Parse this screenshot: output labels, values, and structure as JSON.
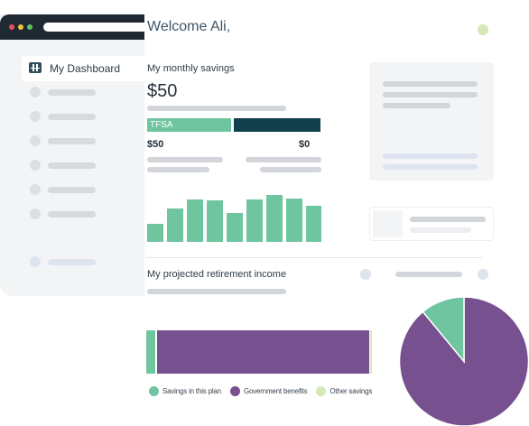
{
  "colors": {
    "green": "#6fc59f",
    "teal_dark": "#123f4c",
    "purple": "#76508f",
    "light_green": "#d4e8b8",
    "dot_red": "#e8505b",
    "dot_yellow": "#f4c542",
    "dot_green": "#5cc46b"
  },
  "sidebar": {
    "active_item": {
      "label": "My Dashboard",
      "icon": "grid-icon"
    }
  },
  "header": {
    "welcome": "Welcome Ali,"
  },
  "savings": {
    "title": "My monthly savings",
    "amount": "$50",
    "split_label": "TFSA",
    "left_value": "$50",
    "right_value": "$0",
    "split_fraction": 0.49
  },
  "mini_bars": [
    0.38,
    0.72,
    0.9,
    0.88,
    0.62,
    0.9,
    1.0,
    0.92,
    0.76,
    0.9
  ],
  "retirement": {
    "title": "My projected retirement income",
    "legend": [
      "Savings in this plan",
      "Government benefits",
      "Other savings"
    ]
  },
  "chart_data": {
    "type": "pie",
    "labels": [
      "Government benefits",
      "Savings in this plan"
    ],
    "values": [
      89,
      11
    ],
    "stacked_bar_fractions": {
      "Savings in this plan": 0.04,
      "Government benefits": 0.95,
      "Other savings": 0.01
    }
  }
}
